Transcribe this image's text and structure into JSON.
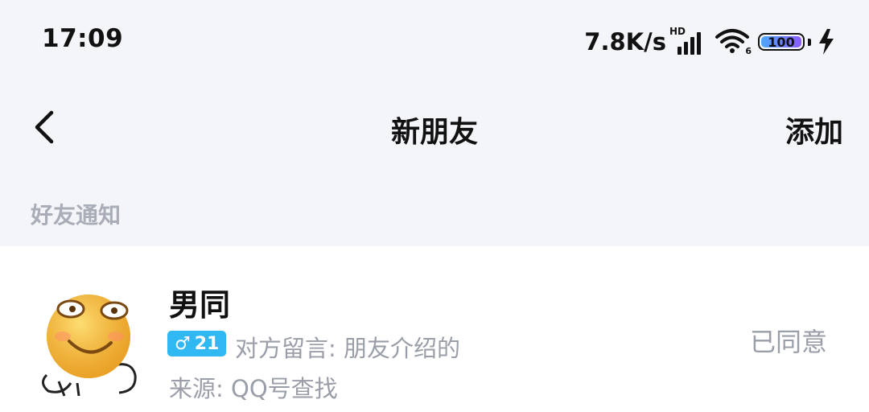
{
  "status_bar": {
    "time": "17:09",
    "net_speed": "7.8K/s",
    "signal_tag": "HD",
    "wifi_sub": "6",
    "battery_pct": "100",
    "battery_colors": [
      "#4aa8ff",
      "#8a5cff"
    ]
  },
  "nav": {
    "title": "新朋友",
    "action": "添加"
  },
  "section": {
    "label": "好友通知"
  },
  "requests": [
    {
      "name": "男同",
      "gender_symbol": "♂",
      "age": "21",
      "message": "对方留言: 朋友介绍的",
      "source": "来源: QQ号查找",
      "status": "已同意",
      "badge_color": "#2fb8f2"
    }
  ],
  "icons": {
    "back": "chevron-left-icon",
    "signal": "cellular-signal-icon",
    "wifi": "wifi-icon",
    "battery": "battery-icon",
    "charging": "charging-bolt-icon",
    "avatar": "smiley-face-avatar"
  }
}
